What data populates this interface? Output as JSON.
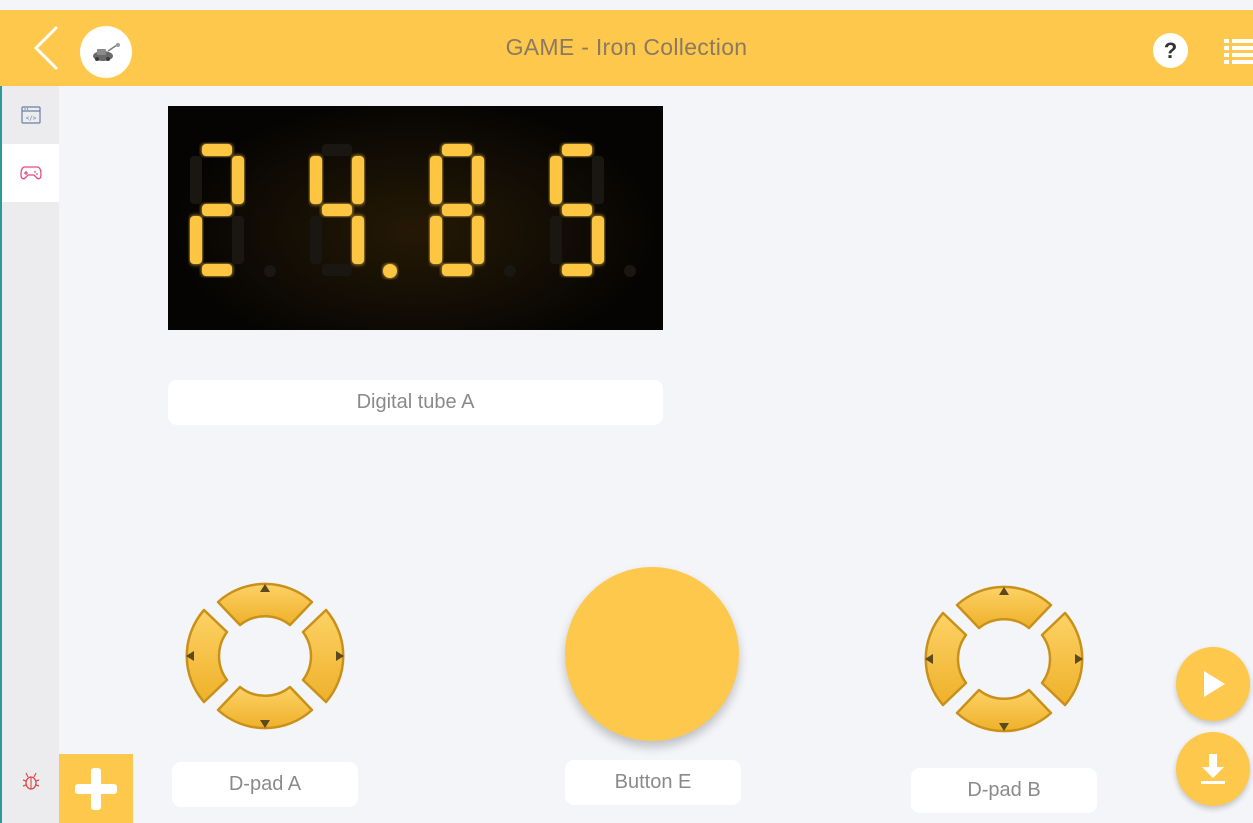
{
  "header": {
    "title": "GAME - Iron Collection",
    "help_label": "?",
    "icons": {
      "back": "chevron-left-icon",
      "logo": "robot-logo-icon",
      "list": "list-icon"
    }
  },
  "sidebar": {
    "items": [
      {
        "name": "code",
        "icon": "code-window-icon",
        "active": false
      },
      {
        "name": "game",
        "icon": "gamepad-icon",
        "active": true
      },
      {
        "name": "debug",
        "icon": "bug-icon",
        "active": false
      }
    ],
    "add_icon": "plus-icon"
  },
  "digital_tube": {
    "label": "Digital tube A",
    "display": "24.85",
    "digits": [
      "2",
      "4",
      "8",
      "5"
    ],
    "decimal_after_digit": 2,
    "segment_color": "#fcc543",
    "ghost_color": "#1a1712"
  },
  "controls": {
    "dpad_a": {
      "label": "D-pad A"
    },
    "button_e": {
      "label": "Button E"
    },
    "dpad_b": {
      "label": "D-pad B"
    }
  },
  "actions": {
    "play_icon": "play-icon",
    "download_icon": "download-icon"
  },
  "colors": {
    "accent": "#fdc84b",
    "header_text": "#8a7a62",
    "background": "#f4f5f8",
    "sidebar": "#ececee",
    "dpad_fill": "#f3bb2e",
    "dpad_edge": "#c9901a",
    "debug_icon": "#e54545",
    "game_icon": "#e24a7a"
  }
}
